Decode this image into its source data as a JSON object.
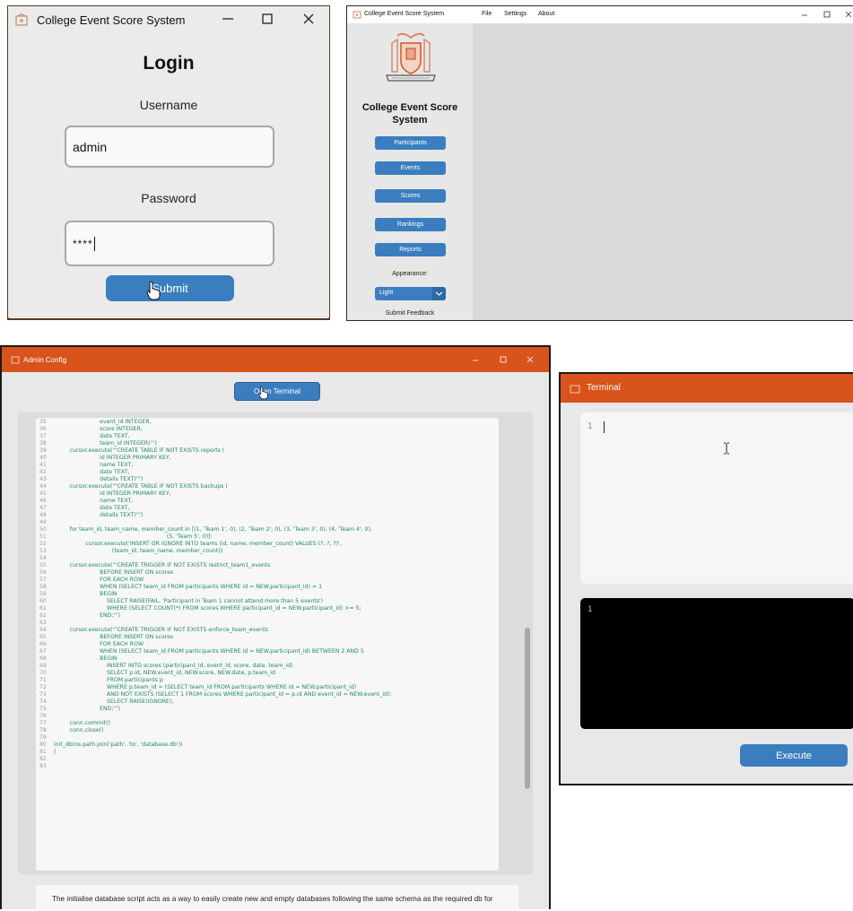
{
  "login": {
    "title": "College Event Score System",
    "heading": "Login",
    "username_label": "Username",
    "username_value": "admin",
    "password_label": "Password",
    "password_value": "****",
    "submit_label": "Submit"
  },
  "main": {
    "title": "College Event Score System",
    "menu": [
      "File",
      "Settings",
      "About"
    ],
    "app_name_line1": "College Event Score",
    "app_name_line2": "System",
    "nav": [
      "Participants",
      "Events",
      "Scores",
      "Rankings",
      "Reports"
    ],
    "appearance_label": "Appearance:",
    "appearance_value": "Light",
    "feedback_label": "Submit Feedback"
  },
  "admin": {
    "title": "Admin Config",
    "open_terminal_label": "Open Terminal",
    "code_lines": [
      {
        "n": "35",
        "t": "                          event_id INTEGER,"
      },
      {
        "n": "36",
        "t": "                          score INTEGER,"
      },
      {
        "n": "37",
        "t": "                          date TEXT,"
      },
      {
        "n": "38",
        "t": "                          team_id INTEGER)''')"
      },
      {
        "n": "39",
        "t": "         cursor.execute('''CREATE TABLE IF NOT EXISTS reports ("
      },
      {
        "n": "40",
        "t": "                          id INTEGER PRIMARY KEY,"
      },
      {
        "n": "41",
        "t": "                          name TEXT,"
      },
      {
        "n": "42",
        "t": "                          date TEXT,"
      },
      {
        "n": "43",
        "t": "                          details TEXT)''')"
      },
      {
        "n": "44",
        "t": "         cursor.execute('''CREATE TABLE IF NOT EXISTS backups ("
      },
      {
        "n": "45",
        "t": "                          id INTEGER PRIMARY KEY,"
      },
      {
        "n": "46",
        "t": "                          name TEXT,"
      },
      {
        "n": "47",
        "t": "                          date TEXT,"
      },
      {
        "n": "48",
        "t": "                          details TEXT)''')"
      },
      {
        "n": "49",
        "t": ""
      },
      {
        "n": "50",
        "t": "         for team_id, team_name, member_count in [(1, 'Team 1', 0), (2, 'Team 2', 0), (3, 'Team 3', 0), (4, 'Team 4', 0),"
      },
      {
        "n": "51",
        "t": "                                                                (5, 'Team 5', 0)]:"
      },
      {
        "n": "52",
        "t": "                  cursor.execute('INSERT OR IGNORE INTO teams (id, name, member_count) VALUES (?, ?, ?)',"
      },
      {
        "n": "53",
        "t": "                                 (team_id, team_name, member_count))"
      },
      {
        "n": "54",
        "t": ""
      },
      {
        "n": "55",
        "t": "         cursor.execute('''CREATE TRIGGER IF NOT EXISTS restrict_team1_events"
      },
      {
        "n": "56",
        "t": "                          BEFORE INSERT ON scores"
      },
      {
        "n": "57",
        "t": "                          FOR EACH ROW"
      },
      {
        "n": "58",
        "t": "                          WHEN (SELECT team_id FROM participants WHERE id = NEW.participant_id) = 1"
      },
      {
        "n": "59",
        "t": "                          BEGIN"
      },
      {
        "n": "60",
        "t": "                              SELECT RAISE(FAIL, 'Participant in Team 1 cannot attend more than 5 events')"
      },
      {
        "n": "61",
        "t": "                              WHERE (SELECT COUNT(*) FROM scores WHERE participant_id = NEW.participant_id) >= 5;"
      },
      {
        "n": "62",
        "t": "                          END;''')"
      },
      {
        "n": "63",
        "t": ""
      },
      {
        "n": "64",
        "t": "         cursor.execute('''CREATE TRIGGER IF NOT EXISTS enforce_team_events"
      },
      {
        "n": "65",
        "t": "                          BEFORE INSERT ON scores"
      },
      {
        "n": "66",
        "t": "                          FOR EACH ROW"
      },
      {
        "n": "67",
        "t": "                          WHEN (SELECT team_id FROM participants WHERE id = NEW.participant_id) BETWEEN 2 AND 5"
      },
      {
        "n": "68",
        "t": "                          BEGIN"
      },
      {
        "n": "69",
        "t": "                              INSERT INTO scores (participant_id, event_id, score, date, team_id)"
      },
      {
        "n": "70",
        "t": "                              SELECT p.id, NEW.event_id, NEW.score, NEW.date, p.team_id"
      },
      {
        "n": "71",
        "t": "                              FROM participants p"
      },
      {
        "n": "72",
        "t": "                              WHERE p.team_id = (SELECT team_id FROM participants WHERE id = NEW.participant_id)"
      },
      {
        "n": "73",
        "t": "                              AND NOT EXISTS (SELECT 1 FROM scores WHERE participant_id = p.id AND event_id = NEW.event_id);"
      },
      {
        "n": "74",
        "t": "                              SELECT RAISE(IGNORE);"
      },
      {
        "n": "75",
        "t": "                          END;''')"
      },
      {
        "n": "76",
        "t": ""
      },
      {
        "n": "77",
        "t": "         conn.commit()"
      },
      {
        "n": "78",
        "t": "         conn.close()"
      },
      {
        "n": "79",
        "t": ""
      },
      {
        "n": "80",
        "t": "init_db(os.path.join('path', 'to', 'database.db'))"
      },
      {
        "n": "81",
        "t": "|"
      },
      {
        "n": "82",
        "t": ""
      },
      {
        "n": "83",
        "t": ""
      }
    ],
    "description": "The initialise database script acts as a way to easily create new and empty databases following the same schema as the required db for"
  },
  "terminal": {
    "title": "Terminal",
    "editor_line": "1",
    "output_line": "1",
    "execute_label": "Execute"
  },
  "colors": {
    "accent_blue": "#3a7ebf",
    "title_orange": "#d9531c",
    "code_green": "#1f8a63"
  }
}
